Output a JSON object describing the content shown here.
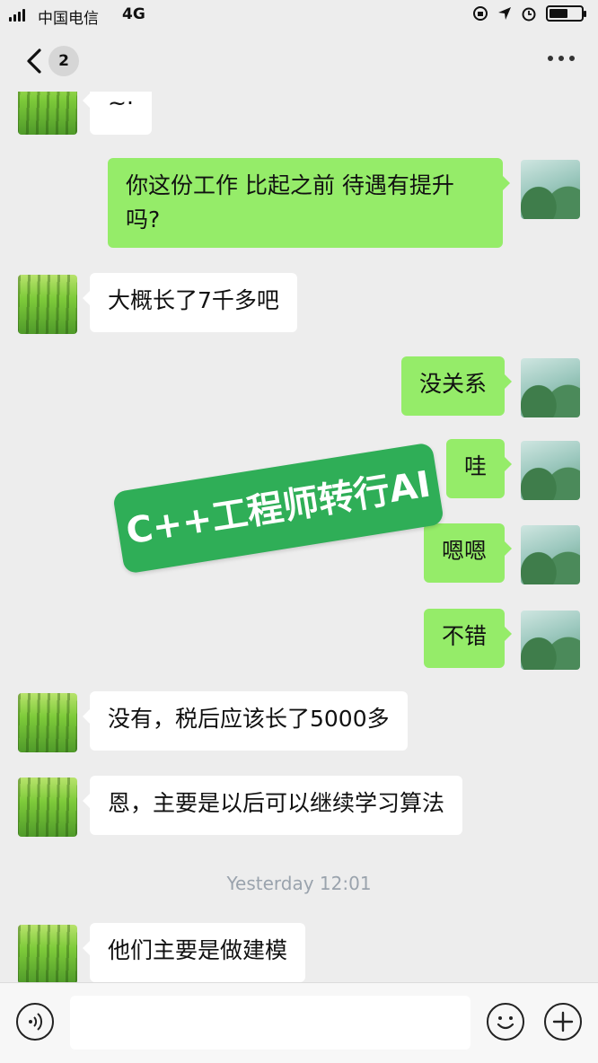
{
  "status_bar": {
    "carrier": "中国电信",
    "network": "4G",
    "battery_level": 0.6
  },
  "nav": {
    "unread_count": "2",
    "more_icon": "more-dots-icon",
    "back_icon": "chevron-left-icon"
  },
  "watermark": "C++工程师转行AI",
  "messages": [
    {
      "side": "in",
      "text": "~·"
    },
    {
      "side": "out",
      "text": "你这份工作 比起之前 待遇有提升吗?"
    },
    {
      "side": "in",
      "text": "大概长了7千多吧"
    },
    {
      "side": "out",
      "text": "没关系"
    },
    {
      "side": "out",
      "text": "哇"
    },
    {
      "side": "out",
      "text": "嗯嗯"
    },
    {
      "side": "out",
      "text": "不错"
    },
    {
      "side": "in",
      "text": "没有，税后应该长了5000多"
    },
    {
      "side": "in",
      "text": "恩，主要是以后可以继续学习算法"
    },
    {
      "side": "in",
      "text": "他们主要是做建模"
    }
  ],
  "timestamp": "Yesterday 12:01",
  "input_bar": {
    "voice_icon": "voice-icon",
    "emoji_icon": "emoji-icon",
    "plus_icon": "plus-icon",
    "text_value": ""
  },
  "colors": {
    "incoming_bubble": "#ffffff",
    "outgoing_bubble": "#95ec69",
    "background": "#ededed",
    "watermark": "#2fae57"
  }
}
